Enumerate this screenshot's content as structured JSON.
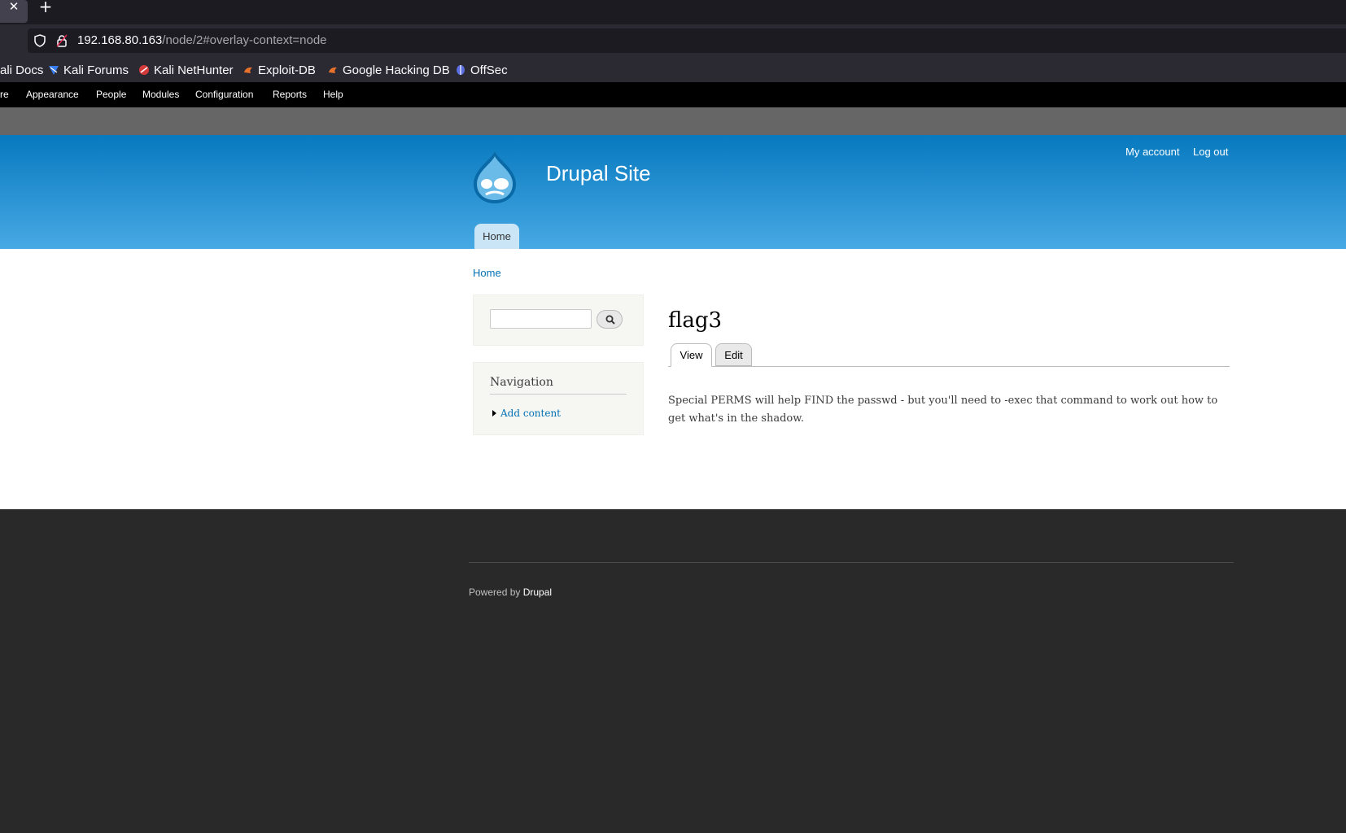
{
  "browser": {
    "tab_close_icon": "close-icon",
    "new_tab_icon": "plus-icon",
    "url_host": "192.168.80.163",
    "url_path": "/node/2#overlay-context=node",
    "bookmarks": [
      "ali Docs",
      "Kali Forums",
      "Kali NetHunter",
      "Exploit-DB",
      "Google Hacking DB",
      "OffSec"
    ]
  },
  "admin_toolbar": {
    "items": [
      "re",
      "Appearance",
      "People",
      "Modules",
      "Configuration",
      "Reports",
      "Help"
    ]
  },
  "header": {
    "site_name": "Drupal Site",
    "my_account": "My account",
    "log_out": "Log out",
    "main_tab": "Home"
  },
  "breadcrumb": "Home",
  "sidebar": {
    "search_value": "",
    "search_icon": "search-icon",
    "navigation_title": "Navigation",
    "add_content": "Add content"
  },
  "content": {
    "title": "flag3",
    "tabs": [
      "View",
      "Edit"
    ],
    "body": "Special PERMS will help FIND the passwd - but you'll need to -exec that command to work out how to get what's in the shadow."
  },
  "footer": {
    "powered_by": "Powered by",
    "drupal_link": "Drupal"
  },
  "colors": {
    "header_top": "#0779bf",
    "header_bottom": "#48a9e4",
    "link": "#0071b3",
    "footer_bg": "#292929"
  }
}
